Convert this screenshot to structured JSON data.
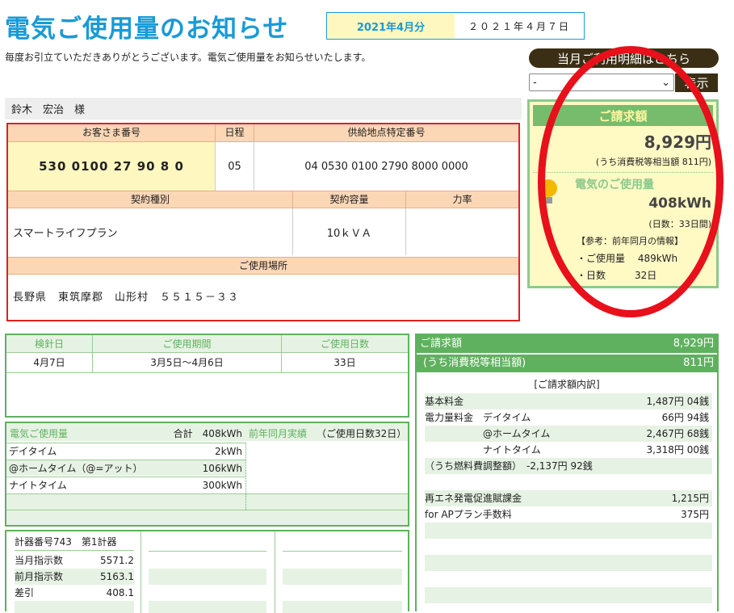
{
  "header": {
    "title": "電気ご使用量のお知らせ",
    "month": "2021年4月分",
    "date": "２０２１年４月７日",
    "greeting": "毎度お引立ていただきありがとうございます。電気ご使用量をお知らせいたします。"
  },
  "detail": {
    "button": "当月ご利用明細はこちら",
    "select_value": "-",
    "show": "表示"
  },
  "customer": {
    "name": "鈴木　宏治　様",
    "no_label": "お客さま番号",
    "no": "530 0100 27 90 8 0",
    "sched_label": "日程",
    "sched": "05",
    "supply_label": "供給地点特定番号",
    "supply": "04 0530 0100 2790 8000 0000",
    "contract_label": "契約種別",
    "contract": "スマートライフプラン",
    "capacity_label": "契約容量",
    "capacity": "10ｋＶＡ",
    "power_label": "力率",
    "power": "",
    "place_label": "ご使用場所",
    "place": "長野県　東筑摩郡　山形村　５５１５－３３"
  },
  "summary": {
    "bill_label": "ご請求額",
    "bill": "8,929円",
    "tax": "(うち消費税等相当額 811円)",
    "usage_label": "電気のご使用量",
    "usage": "408kWh",
    "days": "(日数：33日間)",
    "ref": "【参考：前年同月の情報】",
    "ref_use": "・ご使用量　 489kWh",
    "ref_days": "・日数　　　32日"
  },
  "meter": {
    "h1": "検針日",
    "h2": "ご使用期間",
    "h3": "ご使用日数",
    "v1": "4月7日",
    "v2": "3月5日～4月6日",
    "v3": "33日"
  },
  "usage": {
    "label": "電気ご使用量",
    "total": "合計　408kWh",
    "prev": "前年同月実績",
    "prev_days": "（ご使用日数32日）",
    "rows": [
      {
        "k": "デイタイム",
        "v": "2kWh"
      },
      {
        "k": "@ホームタイム（@=アット）",
        "v": "106kWh"
      },
      {
        "k": "ナイトタイム",
        "v": "300kWh"
      }
    ]
  },
  "gauge": {
    "meter_no": "計器番号743",
    "meter_name": "第1計器",
    "rows": [
      {
        "k": "当月指示数",
        "v": "5571.2"
      },
      {
        "k": "前月指示数",
        "v": "5163.1"
      },
      {
        "k": "差引",
        "v": "408.1"
      }
    ]
  },
  "billing": {
    "label": "ご請求額",
    "amount": "8,929円",
    "tax_label": "(うち消費税等相当額)",
    "tax": "811円",
    "breakdown": "[ご請求額内訳]",
    "rows": [
      {
        "k": "基本料金",
        "v": "1,487円 04銭"
      },
      {
        "k": "電力量料金　デイタイム",
        "v": "66円 94銭"
      },
      {
        "k": "　　　　　　@ホームタイム",
        "v": "2,467円 68銭"
      },
      {
        "k": "　　　　　　ナイトタイム",
        "v": "3,318円 00銭"
      },
      {
        "k": "（うち燃料費調整額）　-2,137円 92銭",
        "v": ""
      },
      {
        "k": "",
        "v": ""
      },
      {
        "k": "再エネ発電促進賦課金",
        "v": "1,215円"
      },
      {
        "k": "for APプラン手数料",
        "v": "375円"
      }
    ]
  }
}
